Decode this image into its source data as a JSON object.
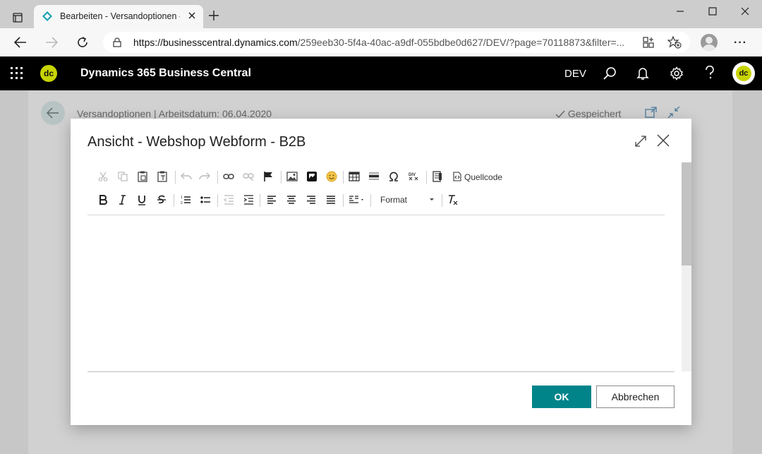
{
  "browser": {
    "tab_title": "Bearbeiten - Versandoptionen - B",
    "url_host": "https://businesscentral.dynamics.com",
    "url_path": "/259eeb30-5f4a-40ac-a9df-055bdbe0d627/DEV/?page=70118873&filter=..."
  },
  "app": {
    "title": "Dynamics 365 Business Central",
    "logo_text": "dc",
    "environment": "DEV",
    "avatar_text": "dc"
  },
  "background_page": {
    "breadcrumb": "Versandoptionen | Arbeitsdatum: 06.04.2020",
    "saved_status": "Gespeichert"
  },
  "dialog": {
    "title": "Ansicht - Webshop Webform - B2B",
    "toolbar": {
      "source_label": "Quellcode",
      "format_label": "Format"
    },
    "editor_content": "",
    "ok_label": "OK",
    "cancel_label": "Abbrechen"
  },
  "colors": {
    "accent": "#00848a",
    "header_bg": "#000000",
    "logo": "#c8d400"
  }
}
